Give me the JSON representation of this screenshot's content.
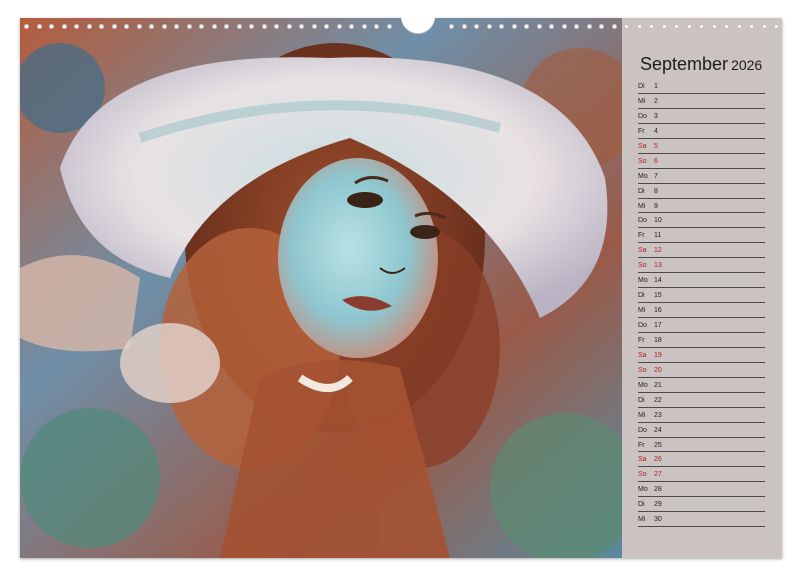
{
  "calendar": {
    "month": "September",
    "year": "2026",
    "days": [
      {
        "weekday": "Di",
        "day": "1",
        "weekend": false
      },
      {
        "weekday": "Mi",
        "day": "2",
        "weekend": false
      },
      {
        "weekday": "Do",
        "day": "3",
        "weekend": false
      },
      {
        "weekday": "Fr",
        "day": "4",
        "weekend": false
      },
      {
        "weekday": "Sa",
        "day": "5",
        "weekend": true
      },
      {
        "weekday": "So",
        "day": "6",
        "weekend": true
      },
      {
        "weekday": "Mo",
        "day": "7",
        "weekend": false
      },
      {
        "weekday": "Di",
        "day": "8",
        "weekend": false
      },
      {
        "weekday": "Mi",
        "day": "9",
        "weekend": false
      },
      {
        "weekday": "Do",
        "day": "10",
        "weekend": false
      },
      {
        "weekday": "Fr",
        "day": "11",
        "weekend": false
      },
      {
        "weekday": "Sa",
        "day": "12",
        "weekend": true
      },
      {
        "weekday": "So",
        "day": "13",
        "weekend": true
      },
      {
        "weekday": "Mo",
        "day": "14",
        "weekend": false
      },
      {
        "weekday": "Di",
        "day": "15",
        "weekend": false
      },
      {
        "weekday": "Mi",
        "day": "16",
        "weekend": false
      },
      {
        "weekday": "Do",
        "day": "17",
        "weekend": false
      },
      {
        "weekday": "Fr",
        "day": "18",
        "weekend": false
      },
      {
        "weekday": "Sa",
        "day": "19",
        "weekend": true
      },
      {
        "weekday": "So",
        "day": "20",
        "weekend": true
      },
      {
        "weekday": "Mo",
        "day": "21",
        "weekend": false
      },
      {
        "weekday": "Di",
        "day": "22",
        "weekend": false
      },
      {
        "weekday": "Mi",
        "day": "23",
        "weekend": false
      },
      {
        "weekday": "Do",
        "day": "24",
        "weekend": false
      },
      {
        "weekday": "Fr",
        "day": "25",
        "weekend": false
      },
      {
        "weekday": "Sa",
        "day": "26",
        "weekend": true
      },
      {
        "weekday": "So",
        "day": "27",
        "weekend": true
      },
      {
        "weekday": "Mo",
        "day": "28",
        "weekend": false
      },
      {
        "weekday": "Di",
        "day": "29",
        "weekend": false
      },
      {
        "weekday": "Mi",
        "day": "30",
        "weekend": false
      }
    ]
  },
  "colors": {
    "panel_background": "#cbc2c2",
    "weekend_text": "#b22222",
    "weekday_text": "#222222",
    "ruling_line": "#4a4a4a"
  },
  "artwork": {
    "subject": "painted-portrait-woman-white-hat-icon"
  }
}
